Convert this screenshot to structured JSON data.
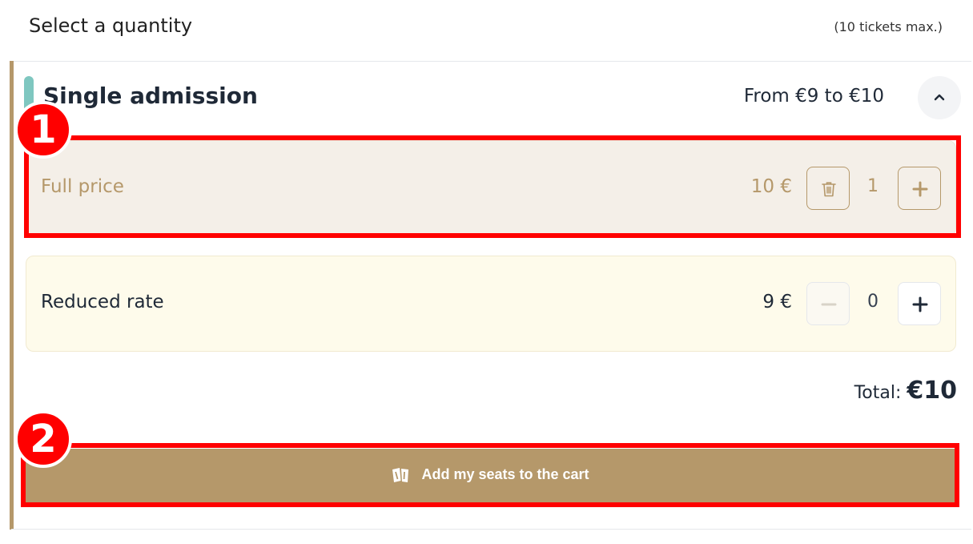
{
  "header": {
    "title": "Select a quantity",
    "limit_note": "(10 tickets max.)"
  },
  "section": {
    "title": "Single admission",
    "price_range": "From €9 to €10",
    "collapse_icon": "chevron-up-icon"
  },
  "rates": [
    {
      "label": "Full price",
      "price": "10 €",
      "quantity": "1",
      "left_icon": "trash-icon",
      "right_icon": "plus-icon"
    },
    {
      "label": "Reduced rate",
      "price": "9 €",
      "quantity": "0",
      "left_icon": "minus-icon",
      "right_icon": "plus-icon"
    }
  ],
  "total": {
    "label": "Total: ",
    "value": "€10"
  },
  "cart_button": {
    "label": "Add my seats to the cart",
    "icon": "tickets-icon"
  },
  "annotations": [
    {
      "number": "1"
    },
    {
      "number": "2"
    }
  ],
  "colors": {
    "accent_gold": "#b5986a",
    "accent_teal": "#7fc7c0",
    "highlight_red": "#ff0000",
    "full_price_bg": "#f4efe8",
    "reduced_bg": "#fefbeb"
  }
}
